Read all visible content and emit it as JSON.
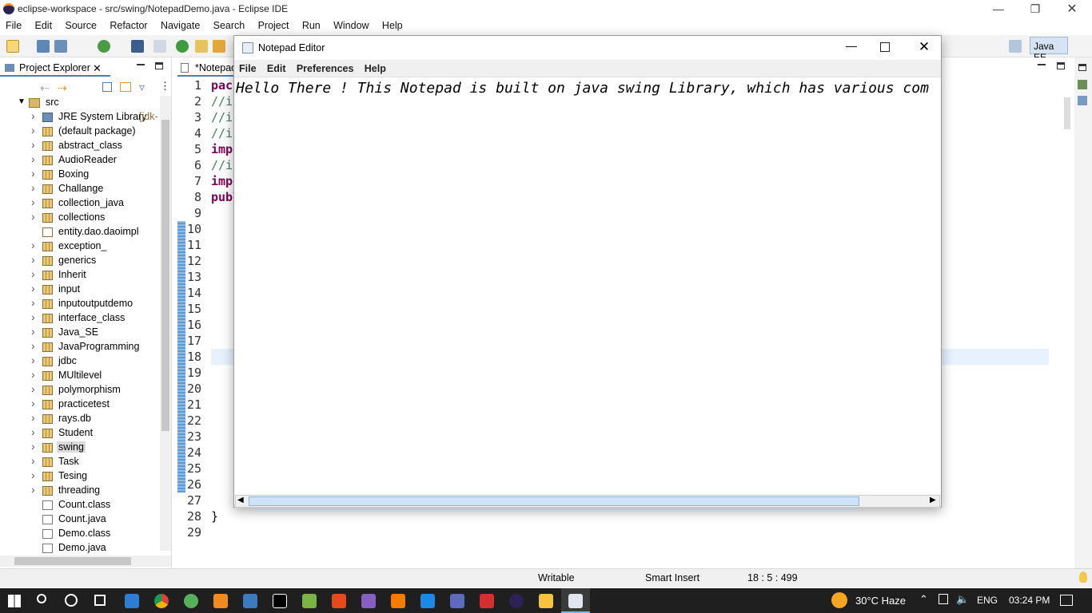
{
  "window": {
    "title": "eclipse-workspace - src/swing/NotepadDemo.java - Eclipse IDE"
  },
  "menu": [
    "File",
    "Edit",
    "Source",
    "Refactor",
    "Navigate",
    "Search",
    "Project",
    "Run",
    "Window",
    "Help"
  ],
  "perspective": "Java EE",
  "project_explorer": {
    "title": "Project Explorer",
    "root": "src",
    "items": [
      {
        "label": "JRE System Library",
        "suffix": "[jdk-",
        "type": "lib"
      },
      {
        "label": "(default package)",
        "type": "pkg"
      },
      {
        "label": "abstract_class",
        "type": "pkg"
      },
      {
        "label": "AudioReader",
        "type": "pkg"
      },
      {
        "label": "Boxing",
        "type": "pkg"
      },
      {
        "label": "Challange",
        "type": "pkg"
      },
      {
        "label": "collection_java",
        "type": "pkg"
      },
      {
        "label": "collections",
        "type": "pkg"
      },
      {
        "label": "entity.dao.daoimpl",
        "type": "pkg-empty"
      },
      {
        "label": "exception_",
        "type": "pkg"
      },
      {
        "label": "generics",
        "type": "pkg"
      },
      {
        "label": "Inherit",
        "type": "pkg"
      },
      {
        "label": "input",
        "type": "pkg"
      },
      {
        "label": "inputoutputdemo",
        "type": "pkg"
      },
      {
        "label": "interface_class",
        "type": "pkg"
      },
      {
        "label": "Java_SE",
        "type": "pkg"
      },
      {
        "label": "JavaProgramming",
        "type": "pkg"
      },
      {
        "label": "jdbc",
        "type": "pkg"
      },
      {
        "label": "MUltilevel",
        "type": "pkg"
      },
      {
        "label": "polymorphism",
        "type": "pkg"
      },
      {
        "label": "practicetest",
        "type": "pkg"
      },
      {
        "label": "rays.db",
        "type": "pkg"
      },
      {
        "label": "Student",
        "type": "pkg"
      },
      {
        "label": "swing",
        "type": "pkg",
        "selected": true
      },
      {
        "label": "Task",
        "type": "pkg"
      },
      {
        "label": "Tesing",
        "type": "pkg"
      },
      {
        "label": "threading",
        "type": "pkg"
      },
      {
        "label": "Count.class",
        "type": "file"
      },
      {
        "label": "Count.java",
        "type": "file"
      },
      {
        "label": "Demo.class",
        "type": "file"
      },
      {
        "label": "Demo.java",
        "type": "file"
      }
    ]
  },
  "editor": {
    "tab": "*Notepad",
    "lines": [
      "1",
      "2",
      "3",
      "4",
      "5",
      "6",
      "7",
      "8",
      "9",
      "10",
      "11",
      "12",
      "13",
      "14",
      "15",
      "16",
      "17",
      "18",
      "19",
      "20",
      "21",
      "22",
      "23",
      "24",
      "25",
      "26",
      "27",
      "28",
      "29"
    ],
    "code": [
      "pack",
      "//in",
      "//in",
      "//in",
      "impo",
      "//in",
      "impo",
      "publ",
      "",
      "",
      "",
      "",
      "",
      "",
      "",
      "",
      "",
      "",
      "",
      "",
      "",
      "",
      "",
      "",
      "",
      "",
      "",
      "}",
      ""
    ]
  },
  "status": {
    "writable": "Writable",
    "insert_mode": "Smart Insert",
    "position": "18 : 5 : 499"
  },
  "notepad": {
    "title": "Notepad Editor",
    "menu": [
      "File",
      "Edit",
      "Preferences",
      "Help"
    ],
    "text": "Hello There ! This Notepad is built on java swing Library, which has various com"
  },
  "taskbar": {
    "weather": "30°C  Haze",
    "lang": "ENG",
    "time": "03:24 PM"
  }
}
